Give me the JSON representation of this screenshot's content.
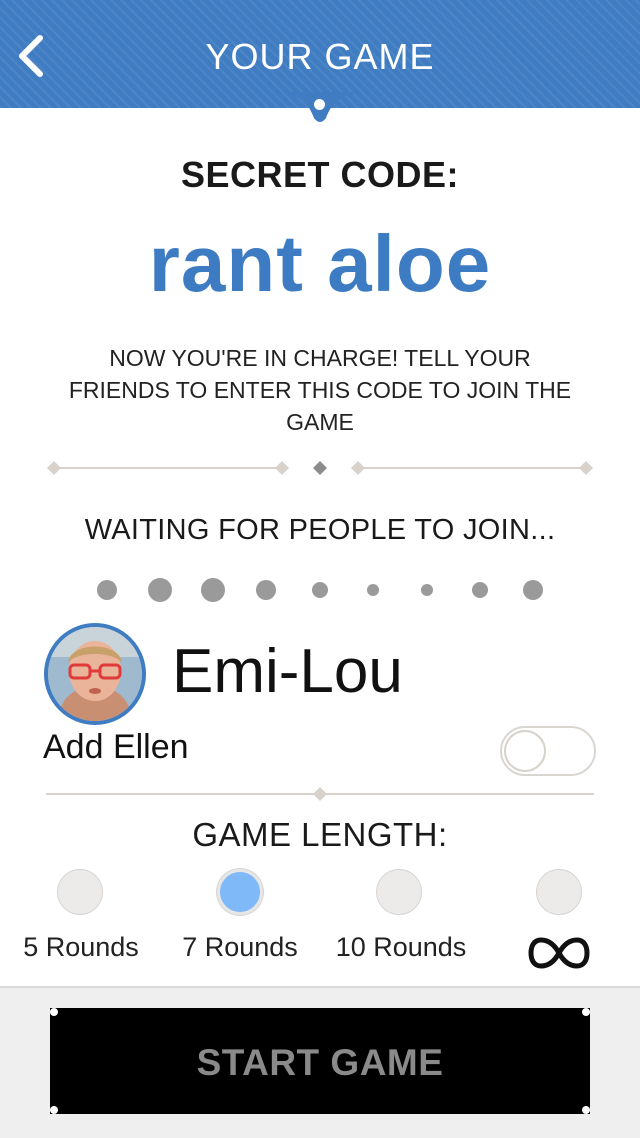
{
  "header": {
    "title": "YOUR GAME",
    "back_icon": "chevron-left-icon",
    "color": "#3f7cc2"
  },
  "secret": {
    "label": "SECRET CODE:",
    "code": "rant aloe",
    "code_color": "#3d7cc3",
    "instructions": "NOW YOU'RE IN CHARGE!  TELL YOUR FRIENDS TO ENTER THIS CODE TO JOIN THE GAME"
  },
  "waiting": {
    "text": "WAITING FOR PEOPLE TO JOIN..."
  },
  "player": {
    "name": "Emi-Lou",
    "avatar": "avatar-photo"
  },
  "add_player": {
    "label": "Add Ellen",
    "toggle_on": false
  },
  "game_length": {
    "label": "GAME LENGTH:",
    "selected": "7 Rounds",
    "selected_color": "#80b9f7",
    "options": [
      {
        "label": "5 Rounds"
      },
      {
        "label": "7 Rounds"
      },
      {
        "label": "10 Rounds"
      },
      {
        "label": "∞",
        "icon": "infinity-icon"
      }
    ]
  },
  "footer": {
    "start_label": "START GAME"
  }
}
